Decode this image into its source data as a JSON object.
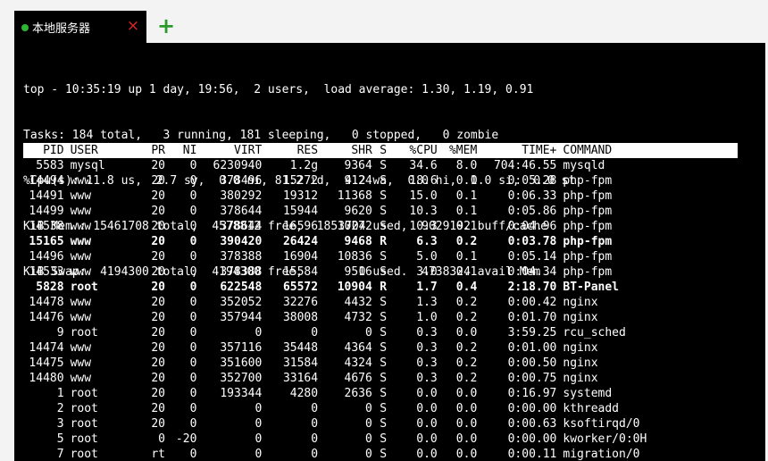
{
  "tab": {
    "label": "本地服务器",
    "status_color": "#2fb52f",
    "close_icon": "×",
    "add_icon": "+"
  },
  "top_summary": {
    "line1": "top - 10:35:19 up 1 day, 19:56,  2 users,  load average: 1.30, 1.19, 0.91",
    "line2": "Tasks: 184 total,   3 running, 181 sleeping,   0 stopped,   0 zombie",
    "line3": "%Cpu(s): 11.8 us,  2.7 sy,  0.0 ni, 81.2 id,  4.2 wa,  0.0 hi,  0.0 si,  0.0 st",
    "line4": "KiB Mem : 15461708 total,  4578812 free,  1853704 used,  9029192 buff/cache",
    "line5": "KiB Swap:  4194300 total,  4194300 free,        0 used.  4738324 avail Mem"
  },
  "process_table": {
    "columns": [
      "PID",
      "USER",
      "PR",
      "NI",
      "VIRT",
      "RES",
      "SHR",
      "S",
      "%CPU",
      "%MEM",
      "TIME+",
      "COMMAND"
    ],
    "rows": [
      [
        "5583",
        "mysql",
        "20",
        "0",
        "6230940",
        "1.2g",
        "9364",
        "S",
        "34.6",
        "8.0",
        "704:46.55",
        "mysqld"
      ],
      [
        "14494",
        "www",
        "20",
        "0",
        "378496",
        "15272",
        "9124",
        "S",
        "18.6",
        "0.1",
        "0:05.28",
        "php-fpm"
      ],
      [
        "14491",
        "www",
        "20",
        "0",
        "380292",
        "19312",
        "11368",
        "S",
        "15.0",
        "0.1",
        "0:06.33",
        "php-fpm"
      ],
      [
        "14499",
        "www",
        "20",
        "0",
        "378644",
        "15944",
        "9620",
        "S",
        "10.3",
        "0.1",
        "0:05.86",
        "php-fpm"
      ],
      [
        "14538",
        "www",
        "20",
        "0",
        "378644",
        "16596",
        "10272",
        "S",
        "10.3",
        "0.1",
        "0:04.96",
        "php-fpm"
      ],
      [
        "15165",
        "www",
        "20",
        "0",
        "390420",
        "26424",
        "9468",
        "R",
        "6.3",
        "0.2",
        "0:03.78",
        "php-fpm"
      ],
      [
        "14496",
        "www",
        "20",
        "0",
        "378388",
        "16904",
        "10836",
        "S",
        "5.0",
        "0.1",
        "0:05.14",
        "php-fpm"
      ],
      [
        "14533",
        "www",
        "20",
        "0",
        "378388",
        "15584",
        "9516",
        "S",
        "3.0",
        "0.1",
        "0:04.34",
        "php-fpm"
      ],
      [
        "5828",
        "root",
        "20",
        "0",
        "622548",
        "65572",
        "10904",
        "R",
        "1.7",
        "0.4",
        "2:18.70",
        "BT-Panel"
      ],
      [
        "14478",
        "www",
        "20",
        "0",
        "352052",
        "32276",
        "4432",
        "S",
        "1.3",
        "0.2",
        "0:00.42",
        "nginx"
      ],
      [
        "14476",
        "www",
        "20",
        "0",
        "357944",
        "38008",
        "4732",
        "S",
        "1.0",
        "0.2",
        "0:01.70",
        "nginx"
      ],
      [
        "9",
        "root",
        "20",
        "0",
        "0",
        "0",
        "0",
        "S",
        "0.3",
        "0.0",
        "3:59.25",
        "rcu_sched"
      ],
      [
        "14474",
        "www",
        "20",
        "0",
        "357116",
        "35448",
        "4364",
        "S",
        "0.3",
        "0.2",
        "0:01.00",
        "nginx"
      ],
      [
        "14475",
        "www",
        "20",
        "0",
        "351600",
        "31584",
        "4324",
        "S",
        "0.3",
        "0.2",
        "0:00.50",
        "nginx"
      ],
      [
        "14480",
        "www",
        "20",
        "0",
        "352700",
        "33164",
        "4676",
        "S",
        "0.3",
        "0.2",
        "0:00.75",
        "nginx"
      ],
      [
        "1",
        "root",
        "20",
        "0",
        "193344",
        "4280",
        "2636",
        "S",
        "0.0",
        "0.0",
        "0:16.97",
        "systemd"
      ],
      [
        "2",
        "root",
        "20",
        "0",
        "0",
        "0",
        "0",
        "S",
        "0.0",
        "0.0",
        "0:00.00",
        "kthreadd"
      ],
      [
        "3",
        "root",
        "20",
        "0",
        "0",
        "0",
        "0",
        "S",
        "0.0",
        "0.0",
        "0:00.63",
        "ksoftirqd/0"
      ],
      [
        "5",
        "root",
        "0",
        "-20",
        "0",
        "0",
        "0",
        "S",
        "0.0",
        "0.0",
        "0:00.00",
        "kworker/0:0H"
      ],
      [
        "7",
        "root",
        "rt",
        "0",
        "0",
        "0",
        "0",
        "S",
        "0.0",
        "0.0",
        "0:00.11",
        "migration/0"
      ]
    ],
    "bold_rows": [
      5,
      8
    ]
  }
}
